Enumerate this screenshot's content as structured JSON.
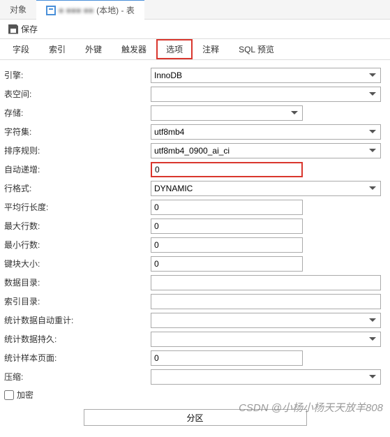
{
  "topTabs": {
    "objects": "对象",
    "active": "(本地) - 表",
    "blurred": "■ ■■■ ■■"
  },
  "toolbar": {
    "save": "保存"
  },
  "subTabs": {
    "fields": "字段",
    "indexes": "索引",
    "foreignKeys": "外键",
    "triggers": "触发器",
    "options": "选项",
    "comments": "注释",
    "sqlPreview": "SQL 预览"
  },
  "labels": {
    "engine": "引擎:",
    "tablespace": "表空间:",
    "storage": "存储:",
    "charset": "字符集:",
    "collation": "排序规则:",
    "autoIncrement": "自动递增:",
    "rowFormat": "行格式:",
    "avgRowLength": "平均行长度:",
    "maxRows": "最大行数:",
    "minRows": "最小行数:",
    "keyBlockSize": "键块大小:",
    "dataDirectory": "数据目录:",
    "indexDirectory": "索引目录:",
    "statsAutoRecalc": "统计数据自动重计:",
    "statsPersistent": "统计数据持久:",
    "statsSamplePages": "统计样本页面:",
    "compression": "压缩:",
    "encryption": "加密"
  },
  "values": {
    "engine": "InnoDB",
    "tablespace": "",
    "storage": "",
    "charset": "utf8mb4",
    "collation": "utf8mb4_0900_ai_ci",
    "autoIncrement": "0",
    "rowFormat": "DYNAMIC",
    "avgRowLength": "0",
    "maxRows": "0",
    "minRows": "0",
    "keyBlockSize": "0",
    "dataDirectory": "",
    "indexDirectory": "",
    "statsAutoRecalc": "",
    "statsPersistent": "",
    "statsSamplePages": "0",
    "compression": ""
  },
  "partition": "分区",
  "watermark": "CSDN @小杨小杨天天放羊808"
}
